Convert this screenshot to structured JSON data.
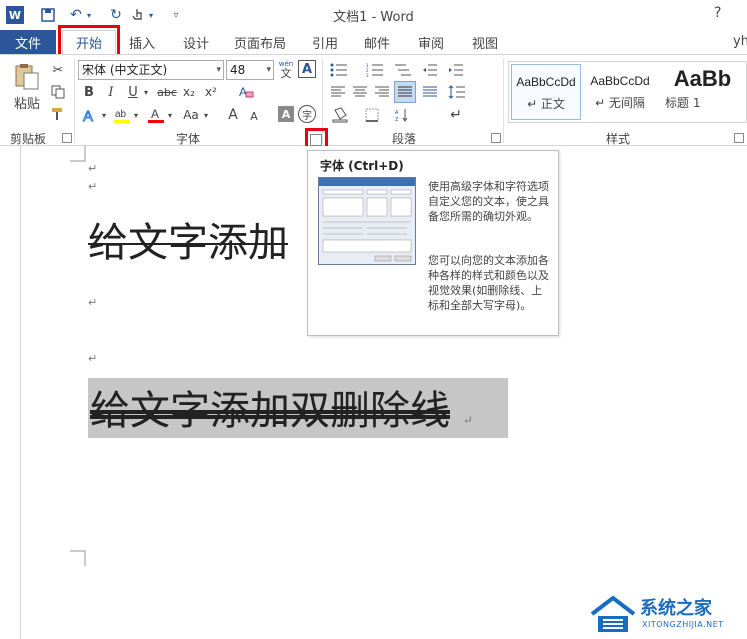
{
  "window": {
    "title": "文档1 - Word",
    "help": "?",
    "user": "yh"
  },
  "qat": {
    "word_icon": "W",
    "save_icon": "save-icon",
    "undo_icon": "↶",
    "redo_icon": "↻",
    "touch_icon": "touch-icon",
    "customize_icon": "≡"
  },
  "tabs": {
    "file": "文件",
    "home": "开始",
    "insert": "插入",
    "design": "设计",
    "layout": "页面布局",
    "references": "引用",
    "mailings": "邮件",
    "review": "审阅",
    "view": "视图"
  },
  "ribbon": {
    "clipboard": {
      "paste_label": "粘贴",
      "group_label": "剪贴板"
    },
    "font": {
      "font_name": "宋体 (中文正文)",
      "font_size": "48",
      "phonetic_top": "wén",
      "phonetic_bottom": "文",
      "border_char": "A",
      "bold": "B",
      "italic": "I",
      "underline": "U",
      "strike": "abc",
      "subscript": "x₂",
      "superscript": "x²",
      "change_case": "Aa",
      "grow": "A",
      "shrink": "A",
      "enclose": "字",
      "group_label": "字体"
    },
    "paragraph": {
      "group_label": "段落"
    },
    "styles": {
      "group_label": "样式",
      "items": [
        {
          "sample": "AaBbCcDd",
          "name": "↵ 正文"
        },
        {
          "sample": "AaBbCcDd",
          "name": "↵ 无间隔"
        },
        {
          "sample": "AaBb",
          "name": "标题 1"
        }
      ]
    }
  },
  "tooltip": {
    "title": "字体 (Ctrl+D)",
    "p1": "使用高级字体和字符选项自定义您的文本，使之具备您所需的确切外观。",
    "p2": "您可以向您的文本添加各种各样的样式和颜色以及视觉效果(如删除线、上标和全部大写字母)。"
  },
  "document": {
    "line1": "给文字添加",
    "line2": "给文字添加双删除线",
    "para_mark": "↵"
  },
  "watermark": {
    "title": "系统之家",
    "url": "XITONGZHIJIA.NET"
  },
  "colors": {
    "accent": "#2b579a",
    "highlight_red": "#e60012",
    "selection_gray": "#c6c6c6",
    "highlighter_yellow": "#ffff00",
    "font_red": "#ff0000"
  }
}
